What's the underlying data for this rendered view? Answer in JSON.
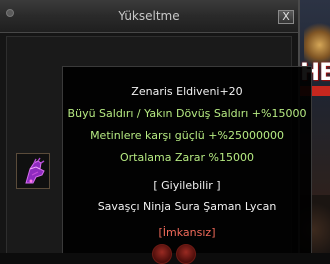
{
  "window": {
    "title": "Yükseltme",
    "close_label": "X"
  },
  "item": {
    "icon": "glove-icon",
    "name": "Zenaris Eldiveni+20",
    "bonuses": [
      "Büyü Saldırı / Yakın Dövüş Saldırı +%15000",
      "Metinlere karşı güçlü +%25000000",
      "Ortalama Zarar %15000"
    ],
    "wearable": "[ Giyilebilir ]",
    "classes": "Savaşçı Ninja Sura Şaman Lycan",
    "status": "[İmkansız]"
  },
  "colors": {
    "name": "#f2f2f2",
    "bonus": "#b6ea82",
    "status": "#f06a5a"
  }
}
